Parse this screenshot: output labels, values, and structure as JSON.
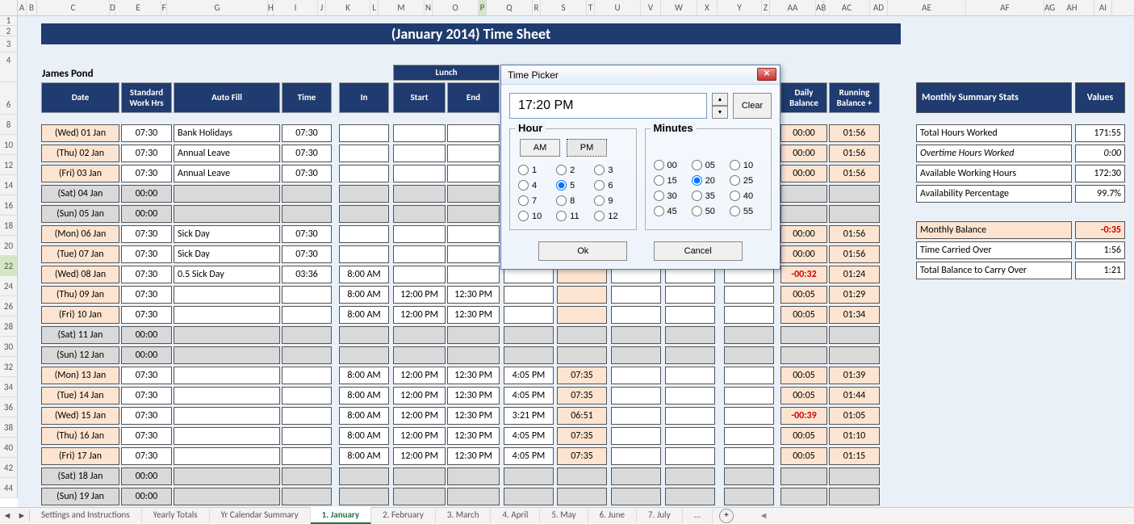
{
  "cols": [
    "A",
    "B",
    "C",
    "D",
    "E",
    "F",
    "G",
    "H",
    "I",
    "J",
    "K",
    "L",
    "M",
    "N",
    "O",
    "P",
    "Q",
    "R",
    "S",
    "T",
    "U",
    "V",
    "W",
    "X",
    "Y",
    "Z",
    "AA",
    "AB",
    "AC",
    "AD",
    "AE",
    "AF",
    "AG",
    "AH",
    "AI"
  ],
  "rowNums": [
    1,
    2,
    3,
    4,
    6,
    8,
    10,
    12,
    14,
    16,
    18,
    20,
    22,
    24,
    26,
    28,
    30,
    32,
    34,
    36,
    38,
    40,
    42,
    44
  ],
  "selCol": "P",
  "selRow": 22,
  "title": "(January 2014) Time Sheet",
  "name": "James Pond",
  "headers": {
    "date": "Date",
    "std": "Standard Work Hrs",
    "auto": "Auto Fill",
    "time": "Time",
    "in": "In",
    "lunch": "Lunch",
    "start": "Start",
    "end": "End",
    "daily": "Daily Balance",
    "running": "Running Balance +"
  },
  "rows": [
    {
      "date": "(Wed) 01 Jan",
      "std": "07:30",
      "auto": "Bank Holidays",
      "time": "07:30",
      "in": "",
      "ls": "",
      "le": "",
      "out": "",
      "hrs": "",
      "db": "00:00",
      "rb": "01:56",
      "wkend": false
    },
    {
      "date": "(Thu) 02 Jan",
      "std": "07:30",
      "auto": "Annual Leave",
      "time": "07:30",
      "in": "",
      "ls": "",
      "le": "",
      "out": "",
      "hrs": "",
      "db": "00:00",
      "rb": "01:56",
      "wkend": false
    },
    {
      "date": "(Fri) 03 Jan",
      "std": "07:30",
      "auto": "Annual Leave",
      "time": "07:30",
      "in": "",
      "ls": "",
      "le": "",
      "out": "",
      "hrs": "",
      "db": "00:00",
      "rb": "01:56",
      "wkend": false
    },
    {
      "date": "(Sat) 04 Jan",
      "std": "00:00",
      "auto": "",
      "time": "",
      "in": "",
      "ls": "",
      "le": "",
      "out": "",
      "hrs": "",
      "db": "",
      "rb": "",
      "wkend": true
    },
    {
      "date": "(Sun) 05 Jan",
      "std": "00:00",
      "auto": "",
      "time": "",
      "in": "",
      "ls": "",
      "le": "",
      "out": "",
      "hrs": "",
      "db": "",
      "rb": "",
      "wkend": true
    },
    {
      "date": "(Mon) 06 Jan",
      "std": "07:30",
      "auto": "Sick Day",
      "time": "07:30",
      "in": "",
      "ls": "",
      "le": "",
      "out": "",
      "hrs": "",
      "db": "00:00",
      "rb": "01:56",
      "wkend": false
    },
    {
      "date": "(Tue) 07 Jan",
      "std": "07:30",
      "auto": "Sick Day",
      "time": "07:30",
      "in": "",
      "ls": "",
      "le": "",
      "out": "",
      "hrs": "",
      "db": "00:00",
      "rb": "01:56",
      "wkend": false
    },
    {
      "date": "(Wed) 08 Jan",
      "std": "07:30",
      "auto": "0.5 Sick Day",
      "time": "03:36",
      "in": "8:00 AM",
      "ls": "",
      "le": "",
      "out": "",
      "hrs": "",
      "db": "-00:32",
      "rb": "01:24",
      "wkend": false,
      "neg": true
    },
    {
      "date": "(Thu) 09 Jan",
      "std": "07:30",
      "auto": "",
      "time": "",
      "in": "8:00 AM",
      "ls": "12:00 PM",
      "le": "12:30 PM",
      "out": "",
      "hrs": "",
      "db": "00:05",
      "rb": "01:29",
      "wkend": false
    },
    {
      "date": "(Fri) 10 Jan",
      "std": "07:30",
      "auto": "",
      "time": "",
      "in": "8:00 AM",
      "ls": "12:00 PM",
      "le": "12:30 PM",
      "out": "",
      "hrs": "",
      "db": "00:05",
      "rb": "01:34",
      "wkend": false
    },
    {
      "date": "(Sat) 11 Jan",
      "std": "00:00",
      "auto": "",
      "time": "",
      "in": "",
      "ls": "",
      "le": "",
      "out": "",
      "hrs": "",
      "db": "",
      "rb": "",
      "wkend": true
    },
    {
      "date": "(Sun) 12 Jan",
      "std": "00:00",
      "auto": "",
      "time": "",
      "in": "",
      "ls": "",
      "le": "",
      "out": "",
      "hrs": "",
      "db": "",
      "rb": "",
      "wkend": true
    },
    {
      "date": "(Mon) 13 Jan",
      "std": "07:30",
      "auto": "",
      "time": "",
      "in": "8:00 AM",
      "ls": "12:00 PM",
      "le": "12:30 PM",
      "out": "4:05 PM",
      "hrs": "07:35",
      "db": "00:05",
      "rb": "01:39",
      "wkend": false
    },
    {
      "date": "(Tue) 14 Jan",
      "std": "07:30",
      "auto": "",
      "time": "",
      "in": "8:00 AM",
      "ls": "12:00 PM",
      "le": "12:30 PM",
      "out": "4:05 PM",
      "hrs": "07:35",
      "db": "00:05",
      "rb": "01:44",
      "wkend": false
    },
    {
      "date": "(Wed) 15 Jan",
      "std": "07:30",
      "auto": "",
      "time": "",
      "in": "8:00 AM",
      "ls": "12:00 PM",
      "le": "12:30 PM",
      "out": "3:21 PM",
      "hrs": "06:51",
      "db": "-00:39",
      "rb": "01:05",
      "wkend": false,
      "neg": true
    },
    {
      "date": "(Thu) 16 Jan",
      "std": "07:30",
      "auto": "",
      "time": "",
      "in": "8:00 AM",
      "ls": "12:00 PM",
      "le": "12:30 PM",
      "out": "4:05 PM",
      "hrs": "07:35",
      "db": "00:05",
      "rb": "01:10",
      "wkend": false
    },
    {
      "date": "(Fri) 17 Jan",
      "std": "07:30",
      "auto": "",
      "time": "",
      "in": "8:00 AM",
      "ls": "12:00 PM",
      "le": "12:30 PM",
      "out": "4:05 PM",
      "hrs": "07:35",
      "db": "00:05",
      "rb": "01:15",
      "wkend": false
    },
    {
      "date": "(Sat) 18 Jan",
      "std": "00:00",
      "auto": "",
      "time": "",
      "in": "",
      "ls": "",
      "le": "",
      "out": "",
      "hrs": "",
      "db": "",
      "rb": "",
      "wkend": true
    },
    {
      "date": "(Sun) 19 Jan",
      "std": "00:00",
      "auto": "",
      "time": "",
      "in": "",
      "ls": "",
      "le": "",
      "out": "",
      "hrs": "",
      "db": "",
      "rb": "",
      "wkend": true
    }
  ],
  "summary": {
    "hdr1": "Monthly Summary Stats",
    "hdr2": "Values",
    "r1l": "Total Hours Worked",
    "r1v": "171:55",
    "r2l": "Overtime Hours Worked",
    "r2v": "0:00",
    "r3l": "Available Working Hours",
    "r3v": "172:30",
    "r4l": "Availability Percentage",
    "r4v": "99.7%",
    "r5l": "Monthly Balance",
    "r5v": "-0:35",
    "r6l": "Time Carried Over",
    "r6v": "1:56",
    "r7l": "Total Balance to Carry Over",
    "r7v": "1:21"
  },
  "tabs": [
    "Settings and Instructions",
    "Yearly Totals",
    "Yr Calendar Summary",
    "1. January",
    "2. February",
    "3. March",
    "4. April",
    "5. May",
    "6. June",
    "7. July",
    "..."
  ],
  "activeTab": 3,
  "dialog": {
    "title": "Time Picker",
    "time": "17:20 PM",
    "clear": "Clear",
    "hour": "Hour",
    "minutes": "Minutes",
    "am": "AM",
    "pm": "PM",
    "hours": [
      "1",
      "2",
      "3",
      "4",
      "5",
      "6",
      "7",
      "8",
      "9",
      "10",
      "11",
      "12"
    ],
    "mins": [
      "00",
      "05",
      "10",
      "15",
      "20",
      "25",
      "30",
      "35",
      "40",
      "45",
      "50",
      "55"
    ],
    "selHour": "5",
    "selMin": "20",
    "ok": "Ok",
    "cancel": "Cancel"
  }
}
